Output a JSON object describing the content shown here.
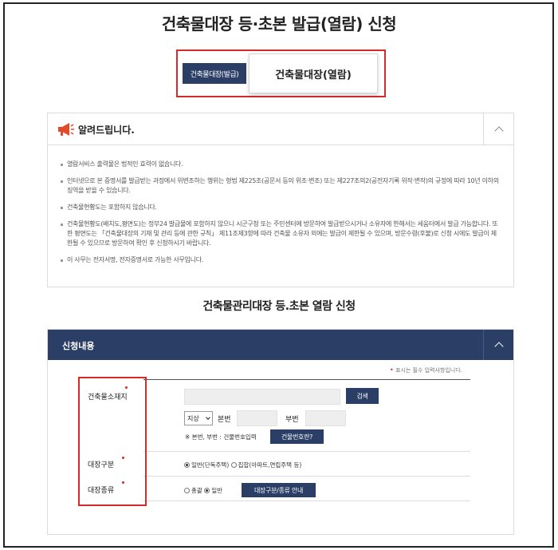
{
  "title": "건축물대장 등·초본 발급(열람) 신청",
  "tabs": [
    {
      "label": "건축물대장(발급)"
    },
    {
      "label": "건축물대장(열람)"
    }
  ],
  "notice": {
    "title": "알려드립니다.",
    "items": [
      "열람서비스 출력물은 법적인 효력이 없습니다.",
      "인터넷으로 본 증명서를 발급받는 과정에서 위변조하는 행위는 형법 제225조(공문서 등의 위조·변조) 또는 제227조의2(공전자기록 위작·변작)의 규정에 따라 10년 이하의 징역을 받을 수 있습니다.",
      "건축물현황도는 포함하지 않습니다.",
      "건축물현황도(배치도,평면도)는 정부24 발급물에 포함하지 않으니 시군구청 또는 주민센터에 방문하여 발급받으시거나 소유자에 한해서는 세움터에서 발급 가능합니다. 또한 평면도는 「건축물대장의 기재 및 관리 등에 관한 규칙」 제11조제3항에 따라 건축물 소유자 외에는 발급이 제한될 수 있으며, 방문수령(후불)로 신청 시에도 발급이 제한될 수 있으므로 방문하여 확인 후 신청하시기 바랍니다.",
      "이 사무는 전자서명, 전자증명서로 가능한 사무입니다."
    ]
  },
  "section_title": "건축물관리대장 등.초본 열람 신청",
  "form": {
    "header": "신청내용",
    "required_note": "표시는 필수 입력사항입니다.",
    "location_label": "건축물소재지",
    "search_button": "검색",
    "land_select": "지상",
    "bonbeon_label": "본번",
    "bubeon_label": "부번",
    "bonbeon_note": "※ 본번, 부번 : 건물번호입력",
    "building_no_button": "건물번호란?",
    "ledger_type_label": "대장구분",
    "ledger_type_options": [
      "일반(단독주택)",
      "집합(아파트,연립주택 등)"
    ],
    "ledger_kind_label": "대장종류",
    "ledger_kind_options": [
      "총괄",
      "일반"
    ],
    "guide_button": "대장구분/종류 안내"
  }
}
